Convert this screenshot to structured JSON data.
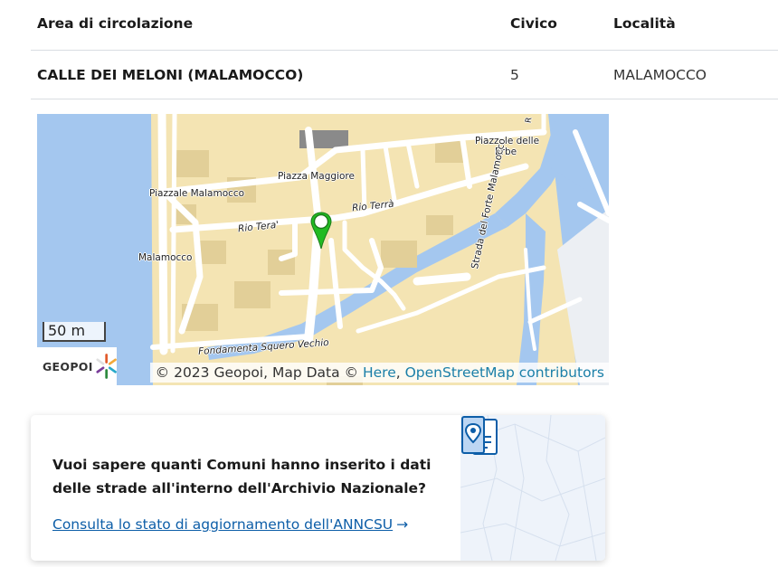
{
  "table": {
    "headers": [
      "Area di circolazione",
      "Civico",
      "Località"
    ],
    "row": {
      "area": "CALLE DEI MELONI (MALAMOCCO)",
      "civico": "5",
      "localita": "MALAMOCCO"
    }
  },
  "map": {
    "labels": {
      "piazzale_erbe_1": "Piazzale delle",
      "piazzale_erbe_2": "Erbe",
      "piazza_maggiore": "Piazza Maggiore",
      "piazzale_malamocco": "Piazzale Malamocco",
      "rio_terra_1": "Rio Terrà",
      "rio_terra_2": "Rio Tera'",
      "malamocco": "Malamocco",
      "fondamenta": "Fondamenta Squero Vechio",
      "strada_forte": "Strada del Forte Malamocco",
      "corner_letter": "R"
    },
    "scale": "50 m",
    "logo_text": "GEOPOI",
    "credits": {
      "prefix": "© 2023 Geopoi, Map Data © ",
      "link1": "Here",
      "sep": ", ",
      "link2": "OpenStreetMap contributors"
    },
    "colors": {
      "land": "#f4e4b3",
      "water": "#a4c7ef",
      "road": "#ffffff",
      "building": "#e2cf98",
      "pin": "#22bb22"
    }
  },
  "card": {
    "question": "Vuoi sapere quanti Comuni hanno inserito i dati delle strade all'interno dell'Archivio Nazionale?",
    "link_text": "Consulta lo stato di aggiornamento dell'ANNCSU",
    "link_arrow": "→",
    "accent": "#0d5ea8"
  }
}
